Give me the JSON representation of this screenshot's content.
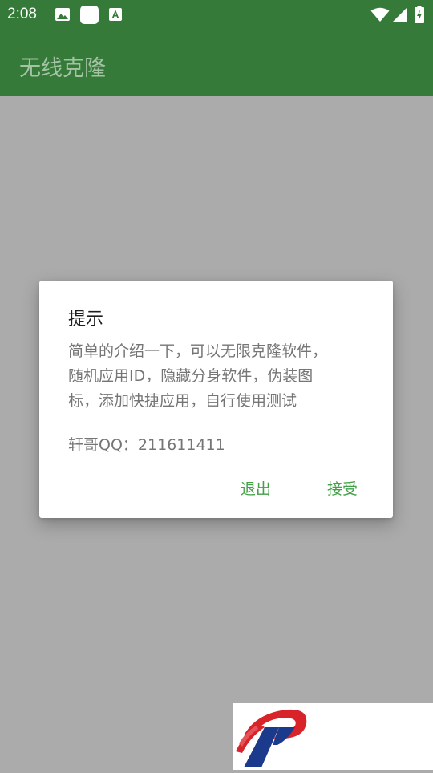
{
  "status_bar": {
    "time": "2:08",
    "icons": [
      "image-icon",
      "white-square-icon",
      "a-text-icon",
      "wifi-icon",
      "signal-icon",
      "battery-charging-icon"
    ]
  },
  "app_bar": {
    "title": "无线克隆"
  },
  "dialog": {
    "title": "提示",
    "message_lines": [
      "简单的介绍一下，可以无限克隆软件，",
      "随机应用ID，隐藏分身软件，伪装图",
      "标，添加快捷应用，自行使用测试"
    ],
    "contact": "轩哥QQ：211611411",
    "buttons": {
      "exit": "退出",
      "accept": "接受"
    }
  },
  "colors": {
    "primary": "#357a38",
    "scrim": "#ababab",
    "accent": "#43a047"
  }
}
